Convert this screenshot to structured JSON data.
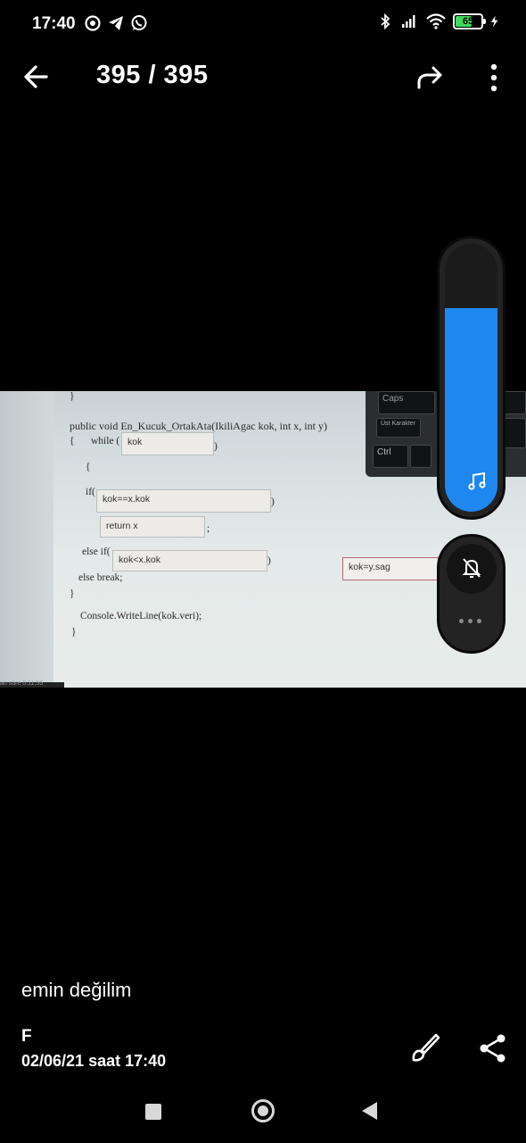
{
  "status_bar": {
    "time": "17:40",
    "battery_level": "65",
    "battery_fraction": 0.65,
    "icons_left": [
      "location-target-icon",
      "telegram-icon",
      "whatsapp-icon"
    ],
    "icons_right": [
      "bluetooth-icon",
      "signal-icon",
      "wifi-icon",
      "battery-icon",
      "charging-icon"
    ]
  },
  "header": {
    "counter": "395 / 395",
    "back_icon": "arrow-left-icon",
    "share_icon": "forward-share-icon",
    "more_icon": "more-vertical-icon"
  },
  "photo": {
    "code_lines": [
      "}",
      "public void En_Kucuk_OrtakAta(IkiliAgac kok, int x, int y)",
      "{",
      "while (",
      ")",
      "{",
      "if(",
      ")",
      ";",
      "else if(",
      ")",
      "else break;",
      "}",
      "Console.WriteLine(kok.veri);",
      "}"
    ],
    "boxes": [
      "kok",
      "kok==x.kok",
      "return x",
      "kok<x.kok",
      "kok=y.sag"
    ],
    "keyboard_keys": [
      "Caps",
      "Üst Karakter",
      "Ctrl"
    ],
    "bottom_strip_text": "an süre 0:11:55"
  },
  "volume_panel": {
    "level": 0.76,
    "music_icon": "music-note-icon",
    "ringer_icon": "bell-off-icon",
    "more_icon": "more-horizontal-icon",
    "accent_color": "#1e88f0"
  },
  "caption": {
    "text": "emin değilim"
  },
  "footer": {
    "sender": "F",
    "datetime": "02/06/21 saat 17:40",
    "edit_icon": "brush-icon",
    "share_icon": "share-icon"
  },
  "nav_bar": {
    "recents_icon": "square-icon",
    "home_icon": "circle-icon",
    "back_icon": "triangle-back-icon"
  }
}
